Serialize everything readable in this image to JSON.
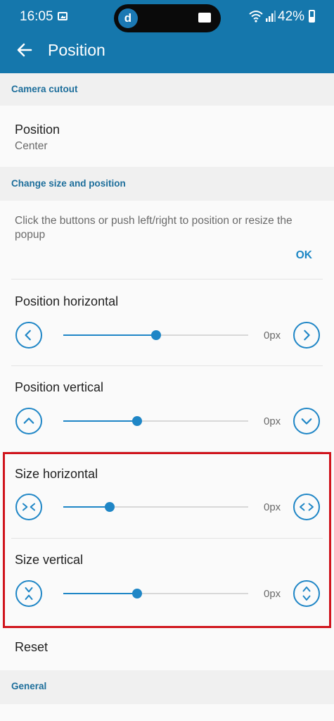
{
  "status_bar": {
    "time": "16:05",
    "battery": "42%"
  },
  "app_bar": {
    "title": "Position"
  },
  "sections": {
    "camera_cutout": "Camera cutout",
    "change_size": "Change size and position",
    "general": "General"
  },
  "position_item": {
    "title": "Position",
    "value": "Center"
  },
  "instructions": {
    "text": "Click the buttons or push left/right to position or resize the popup",
    "ok": "OK"
  },
  "sliders": [
    {
      "label": "Position horizontal",
      "value": "0px",
      "level": 0.5
    },
    {
      "label": "Position vertical",
      "value": "0px",
      "level": 0.4
    },
    {
      "label": "Size horizontal",
      "value": "0px",
      "level": 0.25
    },
    {
      "label": "Size vertical",
      "value": "0px",
      "level": 0.4
    }
  ],
  "reset": {
    "label": "Reset"
  },
  "colors": {
    "accent": "#1f86c6",
    "app_bar": "#1577ac",
    "highlight": "#d0141c"
  }
}
